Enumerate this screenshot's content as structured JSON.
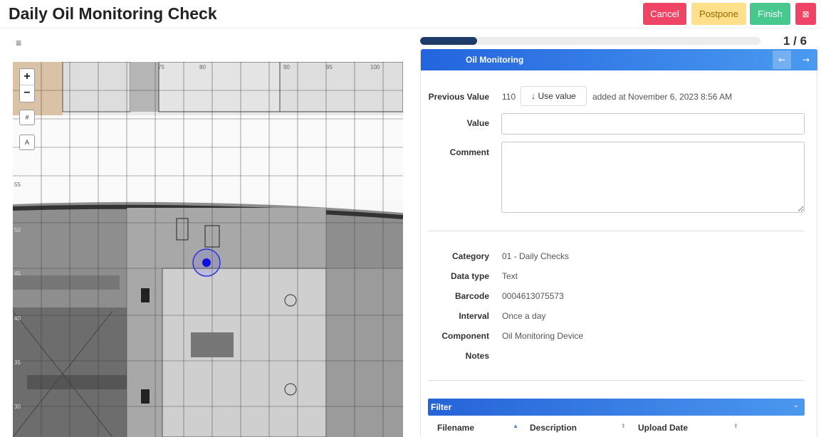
{
  "header": {
    "title": "Daily Oil Monitoring Check",
    "cancel_label": "Cancel",
    "postpone_label": "Postpone",
    "finish_label": "Finish",
    "close_label": "⊠"
  },
  "map": {
    "menu_glyph": "≡",
    "zoom_in": "+",
    "zoom_out": "−",
    "grid_toggle": "#",
    "layer_toggle": "A",
    "top_labels": [
      "75",
      "80",
      "90",
      "90",
      "95",
      "100"
    ],
    "side_labels": [
      "55",
      "50",
      "45",
      "40",
      "35",
      "30"
    ]
  },
  "progress": {
    "fraction": 0.167,
    "step_text": "1 / 6"
  },
  "panel": {
    "title": "Oil Monitoring",
    "prev_icon": "←",
    "next_icon": "→",
    "previous_value_label": "Previous Value",
    "previous_value": "110",
    "use_value_label": "↓  Use value",
    "added_at": "added at November 6, 2023 8:56 AM",
    "value_label": "Value",
    "value_input": "",
    "comment_label": "Comment",
    "comment_input": ""
  },
  "details": [
    {
      "label": "Category",
      "value": "01 - Daily Checks"
    },
    {
      "label": "Data type",
      "value": "Text"
    },
    {
      "label": "Barcode",
      "value": "0004613075573"
    },
    {
      "label": "Interval",
      "value": "Once a day"
    },
    {
      "label": "Component",
      "value": "Oil Monitoring Device"
    },
    {
      "label": "Notes",
      "value": ""
    }
  ],
  "filter": {
    "label": "Filter",
    "chevron": "⌄",
    "columns": [
      "Filename",
      "Description",
      "Upload Date"
    ]
  },
  "colors": {
    "accent": "#2365de",
    "cancel": "#ef4466",
    "postpone": "#ffe08a",
    "finish": "#48c78e",
    "marker": "#1010dd"
  }
}
